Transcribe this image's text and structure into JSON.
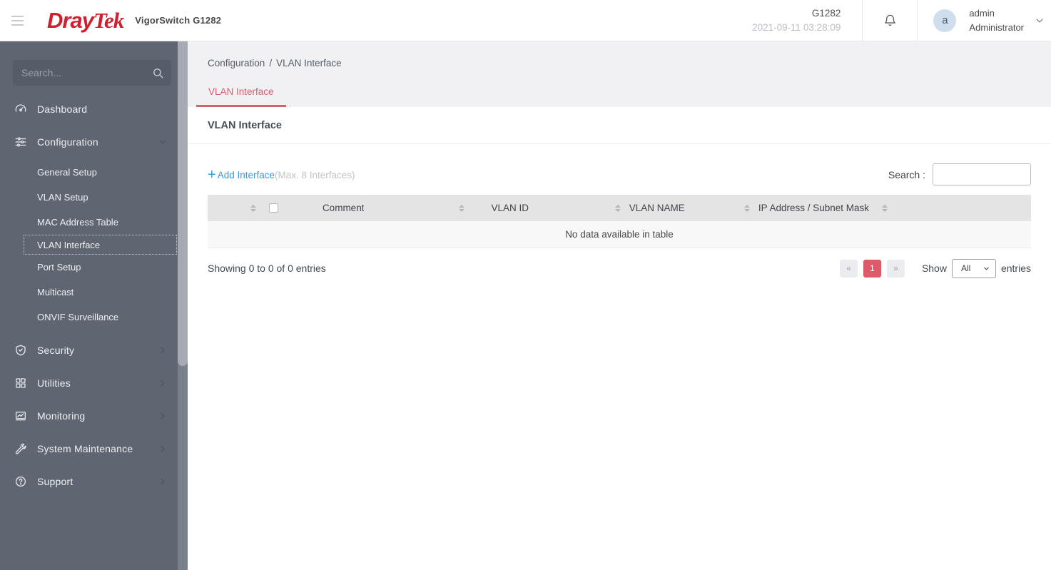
{
  "colors": {
    "accent_red": "#d5606e",
    "pager_red": "#dd5b69",
    "link_blue": "#2d9fdc",
    "sidebar_bg": "#5f6671"
  },
  "topbar": {
    "logo_dray": "Dray",
    "logo_tek": "Tek",
    "product": "VigorSwitch G1282",
    "model": "G1282",
    "datetime": "2021-09-11 03:28:09",
    "user_initial": "a",
    "user_name": "admin",
    "user_role": "Administrator"
  },
  "sidebar": {
    "search_placeholder": "Search...",
    "items": [
      {
        "label": "Dashboard"
      },
      {
        "label": "Configuration"
      },
      {
        "label": "Security"
      },
      {
        "label": "Utilities"
      },
      {
        "label": "Monitoring"
      },
      {
        "label": "System Maintenance"
      },
      {
        "label": "Support"
      }
    ],
    "configuration_children": [
      "General Setup",
      "VLAN Setup",
      "MAC Address Table",
      "VLAN Interface",
      "Port Setup",
      "Multicast",
      "ONVIF Surveillance"
    ],
    "active_child": "VLAN Interface"
  },
  "breadcrumb": {
    "parent": "Configuration",
    "separator": "/",
    "current": "VLAN Interface"
  },
  "tab": {
    "label": "VLAN Interface"
  },
  "page": {
    "title": "VLAN Interface"
  },
  "toolbar": {
    "add_plus": "+",
    "add_label": "Add Interface",
    "add_hint": "(Max. 8 Interfaces)",
    "search_label": "Search :",
    "search_value": ""
  },
  "table": {
    "columns": [
      "Comment",
      "VLAN ID",
      "VLAN NAME",
      "IP Address / Subnet Mask"
    ],
    "rows": [],
    "empty_message": "No data available in table"
  },
  "footer": {
    "showing": "Showing 0 to 0 of 0 entries",
    "prev": "«",
    "page": "1",
    "next": "»",
    "show_label": "Show",
    "per_page": "All",
    "entries_label": "entries"
  }
}
